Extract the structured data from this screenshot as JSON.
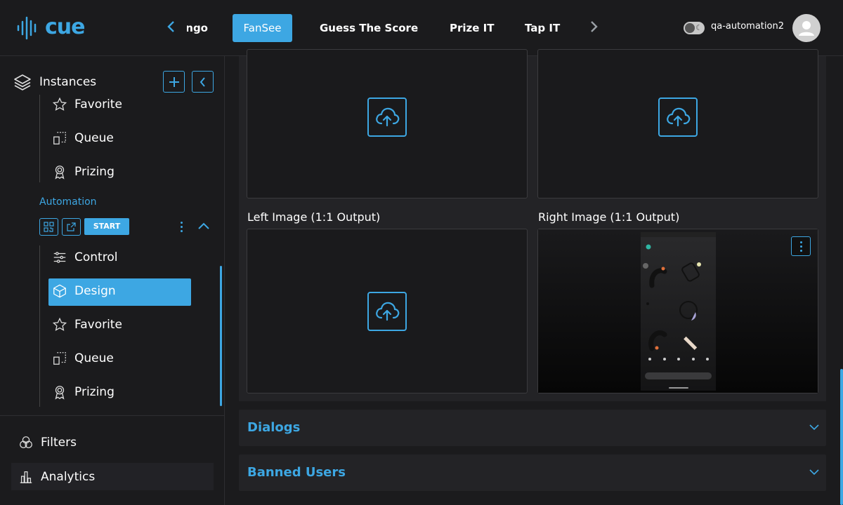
{
  "brand": {
    "logo_text": "cue",
    "accent": "#3da7e3"
  },
  "topnav": {
    "tabs": [
      {
        "label": "ngo"
      },
      {
        "label": "FanSee"
      },
      {
        "label": "Guess The Score"
      },
      {
        "label": "Prize IT"
      },
      {
        "label": "Tap IT"
      }
    ],
    "active_tab": "FanSee",
    "username": "qa-automation2"
  },
  "sidebar": {
    "header_label": "Instances",
    "upper_items": [
      {
        "label": "Favorite",
        "icon": "star-icon"
      },
      {
        "label": "Queue",
        "icon": "queue-icon"
      },
      {
        "label": "Prizing",
        "icon": "award-icon"
      }
    ],
    "section_label": "Automation",
    "start_label": "START",
    "automation_items": [
      {
        "label": "Control",
        "icon": "sliders-icon"
      },
      {
        "label": "Design",
        "icon": "cube-icon"
      },
      {
        "label": "Favorite",
        "icon": "star-icon"
      },
      {
        "label": "Queue",
        "icon": "queue-icon"
      },
      {
        "label": "Prizing",
        "icon": "award-icon"
      }
    ],
    "active_item": "Design",
    "bottom_items": [
      {
        "label": "Filters",
        "icon": "filters-icon"
      },
      {
        "label": "Analytics",
        "icon": "analytics-icon"
      }
    ]
  },
  "main": {
    "left_image_label": "Left Image (1:1 Output)",
    "right_image_label": "Right Image (1:1 Output)",
    "accordions": [
      {
        "title": "Dialogs"
      },
      {
        "title": "Banned Users"
      }
    ]
  }
}
